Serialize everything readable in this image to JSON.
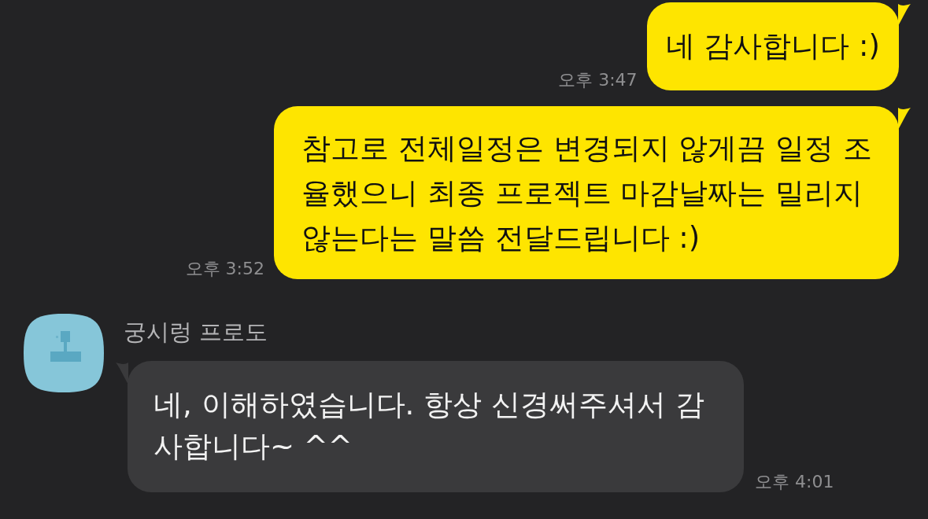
{
  "messages": [
    {
      "kind": "sent",
      "text": "네 감사합니다 :)",
      "time": "오후 3:47"
    },
    {
      "kind": "sent",
      "text": "참고로 전체일정은 변경되지 않게끔 일정 조율했으니 최종 프로젝트 마감날짜는 밀리지 않는다는 말씀 전달드립니다 :)",
      "time": "오후 3:52"
    },
    {
      "kind": "received",
      "sender": "궁시렁 프로도",
      "text": "네, 이해하였습니다. 항상 신경써주셔서 감사합니다~ ^^",
      "time": "오후 4:01"
    }
  ]
}
